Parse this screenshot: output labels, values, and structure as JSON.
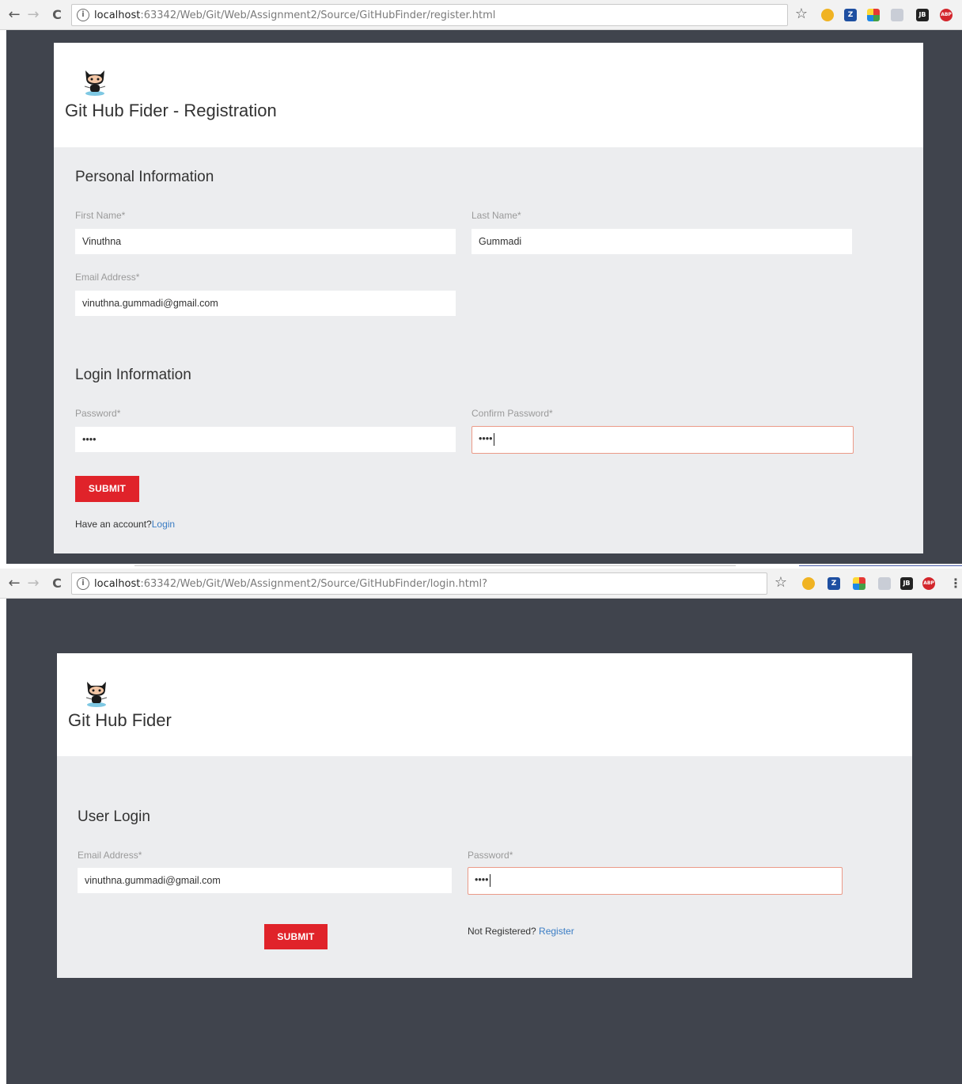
{
  "register_window": {
    "url_host": "localhost",
    "url_rest": ":63342/Web/Git/Web/Assignment2/Source/GitHubFinder/register.html",
    "app_title": "Git Hub Fider - Registration",
    "personal_section_title": "Personal Information",
    "first_name_label": "First Name*",
    "first_name_value": "Vinuthna",
    "last_name_label": "Last Name*",
    "last_name_value": "Gummadi",
    "email_label": "Email Address*",
    "email_value": "vinuthna.gummadi@gmail.com",
    "login_section_title": "Login Information",
    "password_label": "Password*",
    "password_value": "••••",
    "confirm_password_label": "Confirm Password*",
    "confirm_password_value": "••••",
    "submit_label": "SUBMIT",
    "account_prompt": "Have an account?",
    "login_link": "Login"
  },
  "login_window": {
    "url_host": "localhost",
    "url_rest": ":63342/Web/Git/Web/Assignment2/Source/GitHubFinder/login.html?",
    "app_title": "Git Hub Fider",
    "section_title": "User Login",
    "email_label": "Email Address*",
    "email_value": "vinuthna.gummadi@gmail.com",
    "password_label": "Password*",
    "password_value": "••••",
    "submit_label": "SUBMIT",
    "register_prompt": "Not Registered? ",
    "register_link": "Register"
  },
  "browser": {
    "back_icon": "←",
    "forward_icon": "→",
    "reload_icon": "C",
    "info_icon": "i",
    "star_icon": "☆",
    "ext_labels": [
      "Z",
      "JB",
      "ABP"
    ],
    "menu_icon": "⋮"
  },
  "colors": {
    "page_bg": "#40444d",
    "card_body": "#ecedef",
    "submit_red": "#e0232a",
    "link_blue": "#3b7dc4",
    "focus_border": "#eb9a88"
  }
}
